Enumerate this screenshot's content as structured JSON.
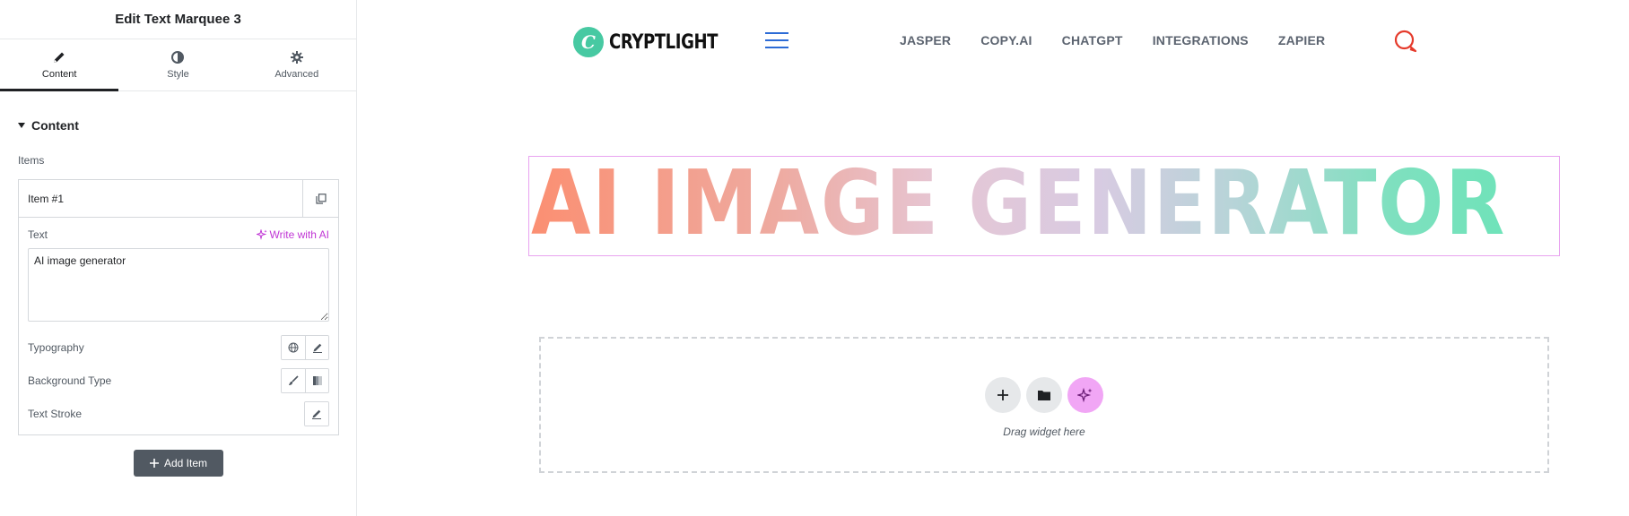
{
  "panel": {
    "title": "Edit Text Marquee 3",
    "tabs": [
      {
        "label": "Content",
        "icon": "pencil-icon",
        "active": true
      },
      {
        "label": "Style",
        "icon": "half-circle-icon",
        "active": false
      },
      {
        "label": "Advanced",
        "icon": "gear-icon",
        "active": false
      }
    ],
    "section_title": "Content",
    "items_label": "Items",
    "item": {
      "title": "Item #1",
      "text_label": "Text",
      "write_ai_label": "Write with AI",
      "text_value": "AI image generator",
      "typography_label": "Typography",
      "background_type_label": "Background Type",
      "text_stroke_label": "Text Stroke"
    },
    "add_item_label": "Add Item"
  },
  "site": {
    "logo_text": "CRYPTLIGHT",
    "logo_letter": "C",
    "nav": [
      "JASPER",
      "COPY.AI",
      "CHATGPT",
      "INTEGRATIONS",
      "ZAPIER"
    ],
    "marquee_text": "AI image generator",
    "dropzone_label": "Drag widget here"
  },
  "colors": {
    "accent_ai": "#c036d5",
    "logo_green": "#47c9a2",
    "hamburger_blue": "#2c6bd6",
    "search_red": "#e53a2b"
  }
}
